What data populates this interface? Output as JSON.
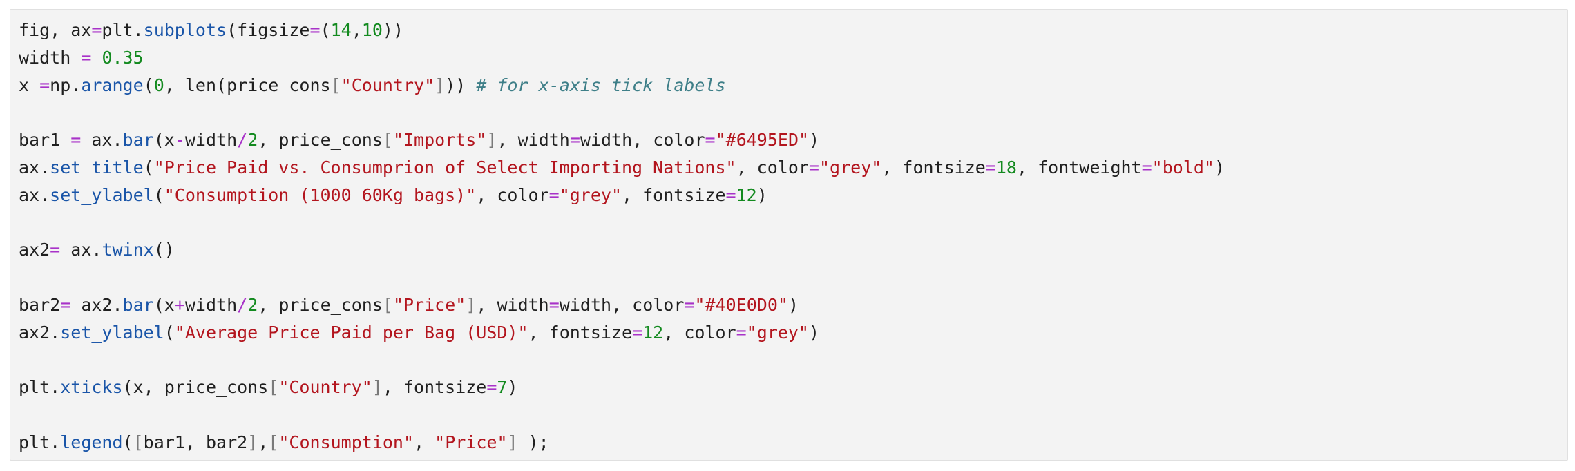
{
  "colors": {
    "cell_background": "#f3f3f3",
    "cell_border": "#e0e0e0",
    "text": "#1f1f1f",
    "operator": "#a832c8",
    "number": "#138a1f",
    "string": "#b3151e",
    "function": "#1a55a8",
    "bracket": "#7a7a7a",
    "comment": "#3e7f88"
  },
  "code_cell": {
    "lines": [
      [
        [
          "fig, ax",
          "text"
        ],
        [
          "=",
          "op"
        ],
        [
          "plt.",
          "text"
        ],
        [
          "subplots",
          "fn"
        ],
        [
          "(figsize",
          "text"
        ],
        [
          "=",
          "op"
        ],
        [
          "(",
          "text"
        ],
        [
          "14",
          "num"
        ],
        [
          ",",
          "text"
        ],
        [
          "10",
          "num"
        ],
        [
          "))",
          "text"
        ]
      ],
      [
        [
          "width ",
          "text"
        ],
        [
          "=",
          "op"
        ],
        [
          " ",
          "text"
        ],
        [
          "0.35",
          "num"
        ]
      ],
      [
        [
          "x ",
          "text"
        ],
        [
          "=",
          "op"
        ],
        [
          "np.",
          "text"
        ],
        [
          "arange",
          "fn"
        ],
        [
          "(",
          "text"
        ],
        [
          "0",
          "num"
        ],
        [
          ", len(price_cons",
          "text"
        ],
        [
          "[",
          "br"
        ],
        [
          "\"Country\"",
          "str"
        ],
        [
          "]",
          "br"
        ],
        [
          ")) ",
          "text"
        ],
        [
          "# for x-axis tick labels",
          "com"
        ]
      ],
      [],
      [
        [
          "bar1 ",
          "text"
        ],
        [
          "=",
          "op"
        ],
        [
          " ax.",
          "text"
        ],
        [
          "bar",
          "fn"
        ],
        [
          "(x",
          "text"
        ],
        [
          "-",
          "op"
        ],
        [
          "width",
          "text"
        ],
        [
          "/",
          "op"
        ],
        [
          "2",
          "num"
        ],
        [
          ", price_cons",
          "text"
        ],
        [
          "[",
          "br"
        ],
        [
          "\"Imports\"",
          "str"
        ],
        [
          "]",
          "br"
        ],
        [
          ", width",
          "text"
        ],
        [
          "=",
          "op"
        ],
        [
          "width, color",
          "text"
        ],
        [
          "=",
          "op"
        ],
        [
          "\"#6495ED\"",
          "str"
        ],
        [
          ")",
          "text"
        ]
      ],
      [
        [
          "ax.",
          "text"
        ],
        [
          "set_title",
          "fn"
        ],
        [
          "(",
          "text"
        ],
        [
          "\"Price Paid vs. Consumprion of Select Importing Nations\"",
          "str"
        ],
        [
          ", color",
          "text"
        ],
        [
          "=",
          "op"
        ],
        [
          "\"grey\"",
          "str"
        ],
        [
          ", fontsize",
          "text"
        ],
        [
          "=",
          "op"
        ],
        [
          "18",
          "num"
        ],
        [
          ", fontweight",
          "text"
        ],
        [
          "=",
          "op"
        ],
        [
          "\"bold\"",
          "str"
        ],
        [
          ")",
          "text"
        ]
      ],
      [
        [
          "ax.",
          "text"
        ],
        [
          "set_ylabel",
          "fn"
        ],
        [
          "(",
          "text"
        ],
        [
          "\"Consumption (1000 60Kg bags)\"",
          "str"
        ],
        [
          ", color",
          "text"
        ],
        [
          "=",
          "op"
        ],
        [
          "\"grey\"",
          "str"
        ],
        [
          ", fontsize",
          "text"
        ],
        [
          "=",
          "op"
        ],
        [
          "12",
          "num"
        ],
        [
          ")",
          "text"
        ]
      ],
      [],
      [
        [
          "ax2",
          "text"
        ],
        [
          "=",
          "op"
        ],
        [
          " ax.",
          "text"
        ],
        [
          "twinx",
          "fn"
        ],
        [
          "()",
          "text"
        ]
      ],
      [],
      [
        [
          "bar2",
          "text"
        ],
        [
          "=",
          "op"
        ],
        [
          " ax2.",
          "text"
        ],
        [
          "bar",
          "fn"
        ],
        [
          "(x",
          "text"
        ],
        [
          "+",
          "op"
        ],
        [
          "width",
          "text"
        ],
        [
          "/",
          "op"
        ],
        [
          "2",
          "num"
        ],
        [
          ", price_cons",
          "text"
        ],
        [
          "[",
          "br"
        ],
        [
          "\"Price\"",
          "str"
        ],
        [
          "]",
          "br"
        ],
        [
          ", width",
          "text"
        ],
        [
          "=",
          "op"
        ],
        [
          "width, color",
          "text"
        ],
        [
          "=",
          "op"
        ],
        [
          "\"#40E0D0\"",
          "str"
        ],
        [
          ")",
          "text"
        ]
      ],
      [
        [
          "ax2.",
          "text"
        ],
        [
          "set_ylabel",
          "fn"
        ],
        [
          "(",
          "text"
        ],
        [
          "\"Average Price Paid per Bag (USD)\"",
          "str"
        ],
        [
          ", fontsize",
          "text"
        ],
        [
          "=",
          "op"
        ],
        [
          "12",
          "num"
        ],
        [
          ", color",
          "text"
        ],
        [
          "=",
          "op"
        ],
        [
          "\"grey\"",
          "str"
        ],
        [
          ")",
          "text"
        ]
      ],
      [],
      [
        [
          "plt.",
          "text"
        ],
        [
          "xticks",
          "fn"
        ],
        [
          "(x, price_cons",
          "text"
        ],
        [
          "[",
          "br"
        ],
        [
          "\"Country\"",
          "str"
        ],
        [
          "]",
          "br"
        ],
        [
          ", fontsize",
          "text"
        ],
        [
          "=",
          "op"
        ],
        [
          "7",
          "num"
        ],
        [
          ")",
          "text"
        ]
      ],
      [],
      [
        [
          "plt.",
          "text"
        ],
        [
          "legend",
          "fn"
        ],
        [
          "(",
          "text"
        ],
        [
          "[",
          "br"
        ],
        [
          "bar1, bar2",
          "text"
        ],
        [
          "]",
          "br"
        ],
        [
          ",",
          "text"
        ],
        [
          "[",
          "br"
        ],
        [
          "\"Consumption\"",
          "str"
        ],
        [
          ", ",
          "text"
        ],
        [
          "\"Price\"",
          "str"
        ],
        [
          "]",
          "br"
        ],
        [
          " );",
          "text"
        ]
      ]
    ]
  }
}
